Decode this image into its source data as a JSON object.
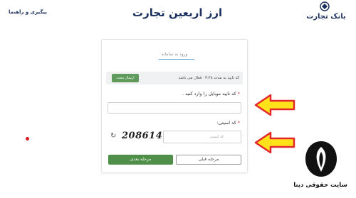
{
  "header": {
    "support_link": "پیگیری و راهنما",
    "app_title": "ارز اربعین تجارت",
    "bank_name": "بانک تجارت"
  },
  "card": {
    "tab_label": "ورود به سامانه",
    "info": {
      "text": "کد تایید به مدت ۰۳:۴۸ فعال می باشد",
      "resend_label": "ارسال مجدد"
    },
    "mobile_code": {
      "label": "کد تایید موبایل را وارد کنید .",
      "value": ""
    },
    "captcha": {
      "label": "کد امنیتی:",
      "image_text": "208614",
      "placeholder": "کد امنیتی",
      "value": ""
    },
    "next_label": "مرحله بعدی",
    "prev_label": "مرحله قبلی"
  },
  "watermark": {
    "text": "سایت حقوقی دینا"
  },
  "colors": {
    "brand_navy": "#1b2f5e",
    "button_green": "#4f8f4a",
    "arrow_yellow": "#ffe21a",
    "arrow_red": "#e3262b"
  },
  "icons": {
    "refresh": "refresh-icon",
    "logo": "bank-emblem-icon"
  }
}
